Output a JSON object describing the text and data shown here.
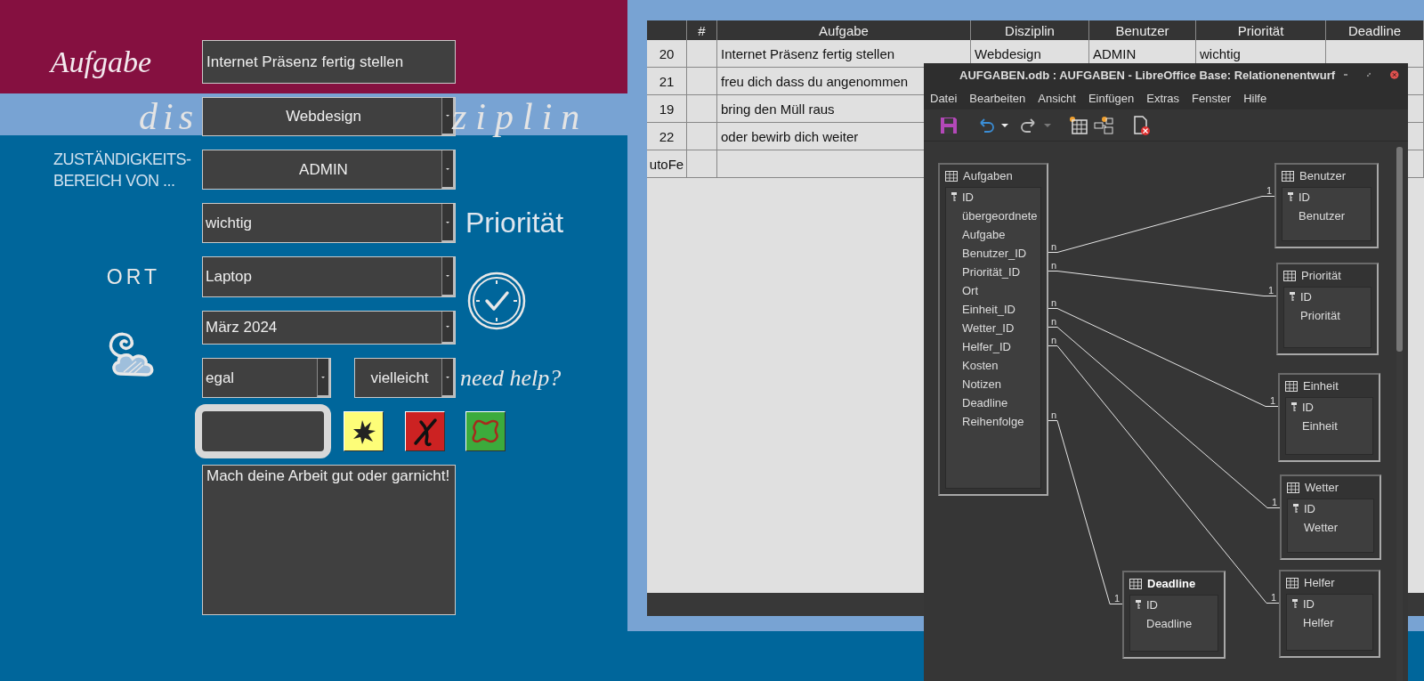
{
  "form": {
    "task": {
      "label": "Aufgabe",
      "value": "Internet Präsenz fertig stellen"
    },
    "discipline": {
      "label_start": "dis",
      "label_end": "ziplin",
      "value": "Webdesign"
    },
    "responsible": {
      "label_lines": [
        "ZUSTÄNDIGKEITS-",
        "BEREICH VON ..."
      ],
      "value": "ADMIN"
    },
    "priority": {
      "label": "Priorität",
      "value": "wichtig"
    },
    "location": {
      "label": "ORT",
      "value": "Laptop"
    },
    "deadline": {
      "value": "März 2024"
    },
    "weather": {
      "value": "egal"
    },
    "help": {
      "label": "need help?",
      "value": "vielleicht"
    },
    "buttons": [
      {
        "kind": "splat"
      },
      {
        "kind": "cross"
      },
      {
        "kind": "ornament"
      }
    ],
    "notes": {
      "value": "Mach deine Arbeit gut oder garnicht!"
    }
  },
  "table": {
    "columns": [
      "#",
      "Aufgabe",
      "Disziplin",
      "Benutzer",
      "Priorität",
      "Deadline"
    ],
    "rows": [
      {
        "row": "20",
        "task": "Internet Präsenz fertig stellen",
        "discipline": "Webdesign",
        "user": "ADMIN",
        "priority": "wichtig"
      },
      {
        "row": "21",
        "task": "freu dich dass du angenommen"
      },
      {
        "row": "19",
        "task": "bring den Müll raus"
      },
      {
        "row": "22",
        "task": "oder bewirb dich weiter"
      },
      {
        "row": "utoFe"
      }
    ]
  },
  "relation_window": {
    "title": "AUFGABEN.odb : AUFGABEN - LibreOffice Base: Relationenentwurf",
    "menu": [
      "Datei",
      "Bearbeiten",
      "Ansicht",
      "Einfügen",
      "Extras",
      "Fenster",
      "Hilfe"
    ],
    "tables": [
      {
        "name": "Aufgaben",
        "selected": false,
        "fields": [
          {
            "name": "ID",
            "key": true
          },
          {
            "name": "übergeordnete",
            "key": false
          },
          {
            "name": "Aufgabe",
            "key": false
          },
          {
            "name": "Benutzer_ID",
            "key": false
          },
          {
            "name": "Priorität_ID",
            "key": false
          },
          {
            "name": "Ort",
            "key": false
          },
          {
            "name": "Einheit_ID",
            "key": false
          },
          {
            "name": "Wetter_ID",
            "key": false
          },
          {
            "name": "Helfer_ID",
            "key": false
          },
          {
            "name": "Kosten",
            "key": false
          },
          {
            "name": "Notizen",
            "key": false
          },
          {
            "name": "Deadline",
            "key": false
          },
          {
            "name": "Reihenfolge",
            "key": false
          }
        ]
      },
      {
        "name": "Benutzer",
        "selected": false,
        "link": {
          "many": "n",
          "one": "1"
        },
        "fields": [
          {
            "name": "ID",
            "key": true
          },
          {
            "name": "Benutzer",
            "key": false
          }
        ]
      },
      {
        "name": "Priorität",
        "selected": false,
        "link": {
          "many": "n",
          "one": "1"
        },
        "fields": [
          {
            "name": "ID",
            "key": true
          },
          {
            "name": "Priorität",
            "key": false
          }
        ]
      },
      {
        "name": "Einheit",
        "selected": false,
        "link": {
          "many": "n",
          "one": "1"
        },
        "fields": [
          {
            "name": "ID",
            "key": true
          },
          {
            "name": "Einheit",
            "key": false
          }
        ]
      },
      {
        "name": "Wetter",
        "selected": false,
        "link": {
          "many": "n",
          "one": "1"
        },
        "fields": [
          {
            "name": "ID",
            "key": true
          },
          {
            "name": "Wetter",
            "key": false
          }
        ]
      },
      {
        "name": "Deadline",
        "selected": true,
        "link": {
          "many": "n",
          "one": "1"
        },
        "fields": [
          {
            "name": "ID",
            "key": true
          },
          {
            "name": "Deadline",
            "key": false
          }
        ]
      },
      {
        "name": "Helfer",
        "selected": false,
        "link": {
          "many": "n",
          "one": "1"
        },
        "fields": [
          {
            "name": "ID",
            "key": true
          },
          {
            "name": "Helfer",
            "key": false
          }
        ]
      }
    ]
  }
}
